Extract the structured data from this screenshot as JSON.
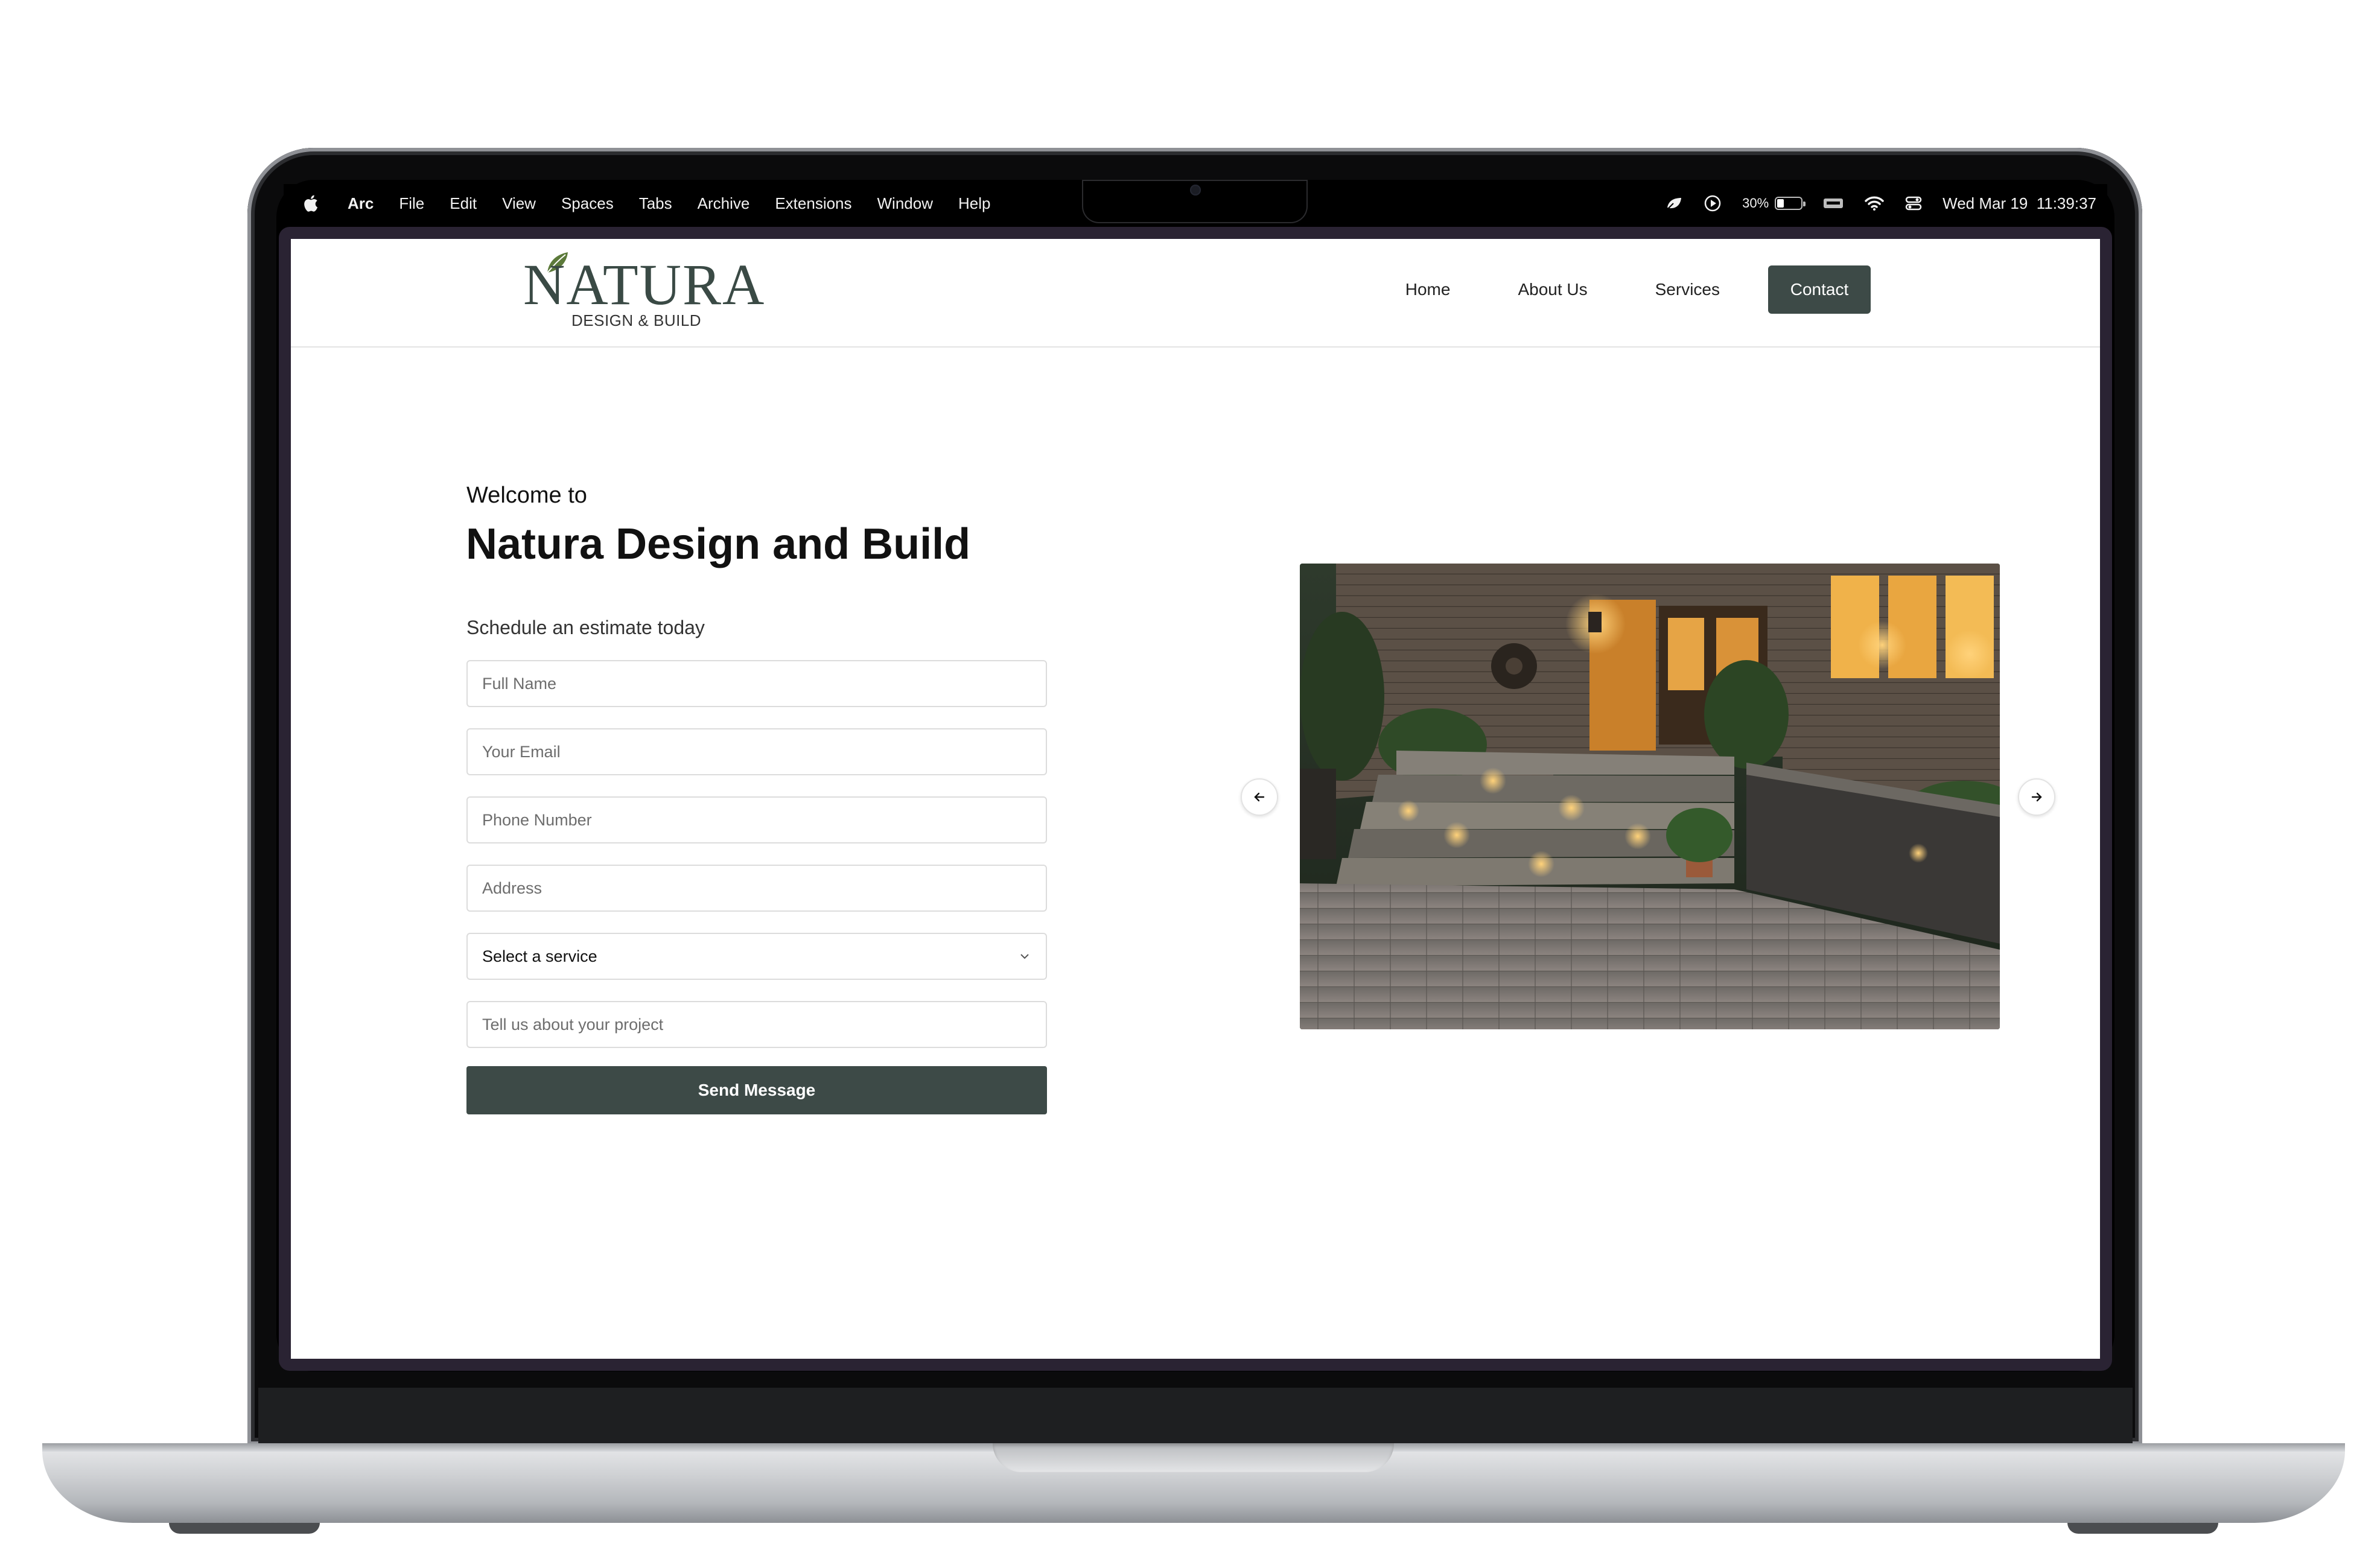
{
  "menubar": {
    "app_name": "Arc",
    "items": [
      "File",
      "Edit",
      "View",
      "Spaces",
      "Tabs",
      "Archive",
      "Extensions",
      "Window",
      "Help"
    ],
    "battery_percent": "30%",
    "battery_level": 0.3,
    "datetime": "Wed Mar 19  11:39:37"
  },
  "site": {
    "logo": {
      "wordmark": "NATURA",
      "tagline": "DESIGN & BUILD"
    },
    "nav": {
      "home": "Home",
      "about": "About Us",
      "services": "Services",
      "contact": "Contact"
    },
    "hero": {
      "welcome": "Welcome to",
      "headline": "Natura Design and Build",
      "subhead": "Schedule an estimate today"
    },
    "form": {
      "full_name_placeholder": "Full Name",
      "email_placeholder": "Your Email",
      "phone_placeholder": "Phone Number",
      "address_placeholder": "Address",
      "service_selected": "Select a service",
      "project_placeholder": "Tell us about your project",
      "submit_label": "Send Message"
    },
    "colors": {
      "brand_dark": "#3d4a47",
      "page_bg": "#ffffff"
    }
  }
}
